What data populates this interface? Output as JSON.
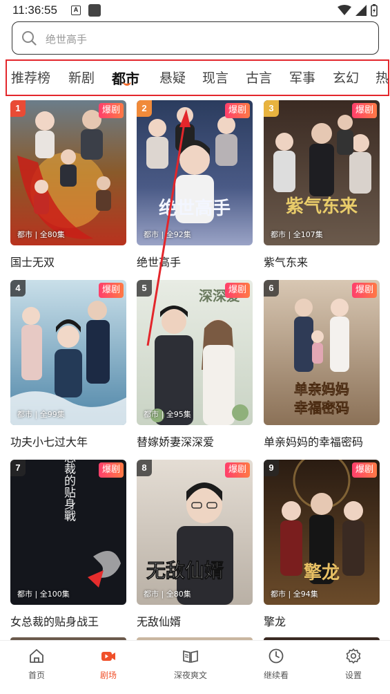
{
  "status_bar": {
    "time": "11:36:55",
    "notif_letter": "A"
  },
  "search": {
    "placeholder": "绝世高手"
  },
  "tabs": [
    {
      "label": "推荐榜"
    },
    {
      "label": "新剧"
    },
    {
      "label": "都市",
      "active": true
    },
    {
      "label": "悬疑"
    },
    {
      "label": "现言"
    },
    {
      "label": "古言"
    },
    {
      "label": "军事"
    },
    {
      "label": "玄幻"
    },
    {
      "label": "热"
    }
  ],
  "badge_hot": "爆剧",
  "dramas": [
    {
      "rank": "1",
      "title": "国士无双",
      "meta": "都市 | 全80集"
    },
    {
      "rank": "2",
      "title": "绝世高手",
      "meta": "都市 | 全92集"
    },
    {
      "rank": "3",
      "title": "紫气东来",
      "meta": "都市 | 全107集"
    },
    {
      "rank": "4",
      "title": "功夫小七过大年",
      "meta": "都市 | 全99集"
    },
    {
      "rank": "5",
      "title": "替嫁娇妻深深爱",
      "meta": "都市 | 全95集"
    },
    {
      "rank": "6",
      "title": "单亲妈妈的幸福密码",
      "meta": ""
    },
    {
      "rank": "7",
      "title": "女总裁的贴身战王",
      "meta": "都市 | 全100集"
    },
    {
      "rank": "8",
      "title": "无敌仙婿",
      "meta": "都市 | 全80集"
    },
    {
      "rank": "9",
      "title": "擎龙",
      "meta": "都市 | 全94集"
    }
  ],
  "cover_texts": {
    "c2": "绝世高手",
    "c3": "紫气东来",
    "c5": "深深爱",
    "c6a": "单亲妈妈",
    "c6b": "幸福密码",
    "c7": "女总裁的贴身戰",
    "c8": "无敌仙婿",
    "c9": "擎龙"
  },
  "bottom_nav": [
    {
      "label": "首页",
      "icon": "home-icon"
    },
    {
      "label": "剧场",
      "icon": "theater-icon",
      "active": true
    },
    {
      "label": "深夜爽文",
      "icon": "book-icon"
    },
    {
      "label": "继续看",
      "icon": "clock-icon"
    },
    {
      "label": "设置",
      "icon": "gear-icon"
    }
  ],
  "colors": {
    "accent": "#f0502a",
    "highlight_frame": "#e3262b",
    "hot_badge": "#ff3f6c"
  }
}
